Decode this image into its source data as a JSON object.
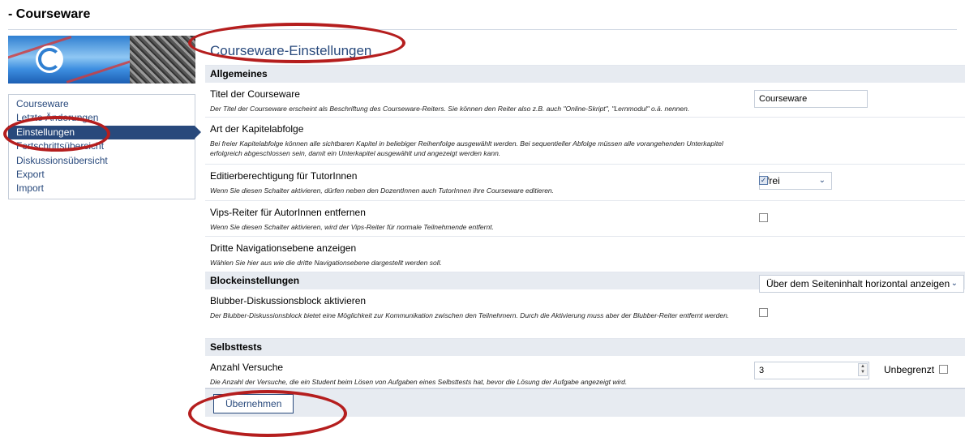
{
  "page": {
    "title": "- Courseware"
  },
  "sidebar": {
    "items": [
      {
        "label": "Courseware",
        "active": false
      },
      {
        "label": "Letzte Änderungen",
        "active": false
      },
      {
        "label": "Einstellungen",
        "active": true
      },
      {
        "label": "Fortschrittsübersicht",
        "active": false
      },
      {
        "label": "Diskussionsübersicht",
        "active": false
      },
      {
        "label": "Export",
        "active": false
      },
      {
        "label": "Import",
        "active": false
      }
    ]
  },
  "main": {
    "title": "Courseware-Einstellungen",
    "sections": {
      "general": "Allgemeines",
      "blocks": "Blockeinstellungen",
      "selftests": "Selbsttests"
    },
    "settings": {
      "title": {
        "label": "Titel der Courseware",
        "desc": "Der Titel der Courseware erscheint als Beschriftung des Courseware-Reiters. Sie können den Reiter also z.B. auch \"Online-Skript\", \"Lernmodul\" o.ä. nennen.",
        "value": "Courseware"
      },
      "chapter_order": {
        "label": "Art der Kapitelabfolge",
        "desc": "Bei freier Kapitelabfolge können alle sichtbaren Kapitel in beliebiger Reihenfolge ausgewählt werden. Bei sequentieller Abfolge müssen alle vorangehenden Unterkapitel erfolgreich abgeschlossen sein, damit ein Unterkapitel ausgewählt und angezeigt werden kann.",
        "value": "frei"
      },
      "tutor_edit": {
        "label": "Editierberechtigung für TutorInnen",
        "desc": "Wenn Sie diesen Schalter aktivieren, dürfen neben den DozentInnen auch TutorInnen ihre Courseware editieren.",
        "checked": true
      },
      "vips_tab": {
        "label": "Vips-Reiter für AutorInnen entfernen",
        "desc": "Wenn Sie diesen Schalter aktivieren, wird der Vips-Reiter für normale Teilnehmende entfernt.",
        "checked": false
      },
      "third_nav": {
        "label": "Dritte Navigationsebene anzeigen",
        "desc": "Wählen Sie hier aus wie die dritte Navigationsebene dargestellt werden soll.",
        "value": "Über dem Seiteninhalt horizontal anzeigen"
      },
      "blubber": {
        "label": "Blubber-Diskussionsblock aktivieren",
        "desc": "Der Blubber-Diskussionsblock bietet eine Möglichkeit zur Kommunikation zwischen den Teilnehmern. Durch die Aktivierung muss aber der Blubber-Reiter entfernt werden.",
        "checked": false
      },
      "attempts": {
        "label": "Anzahl Versuche",
        "desc": "Die Anzahl der Versuche, die ein Student beim Lösen von Aufgaben eines Selbsttests hat, bevor die Lösung der Aufgabe angezeigt wird.",
        "value": "3",
        "unlimited_label": "Unbegrenzt",
        "unlimited_checked": false
      }
    },
    "submit_label": "Übernehmen"
  },
  "colors": {
    "accent": "#28497c",
    "annotation": "#b51e1e",
    "section_bg": "#e7ebf1"
  }
}
